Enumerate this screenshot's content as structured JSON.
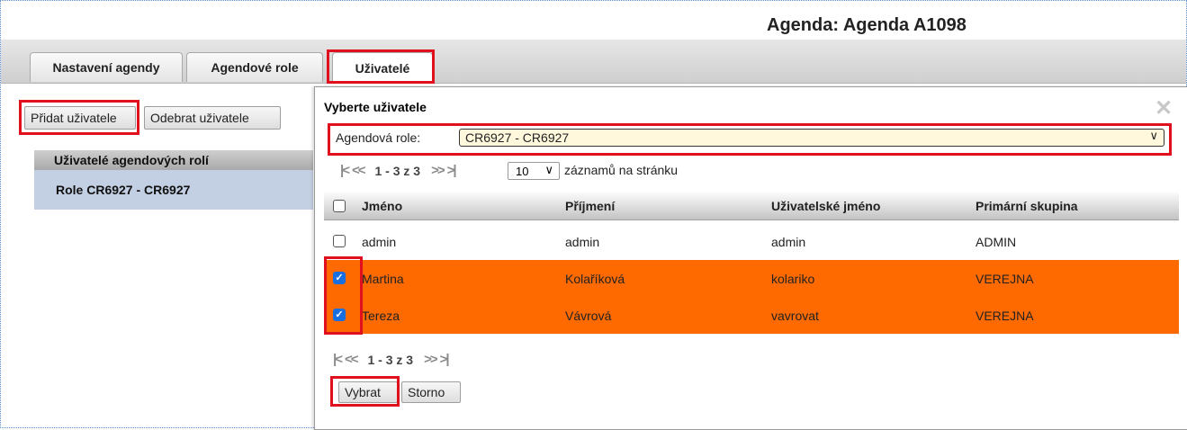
{
  "header": {
    "agenda_title": "Agenda: Agenda A1098"
  },
  "tabs": [
    {
      "label": "Nastavení agendy"
    },
    {
      "label": "Agendové role"
    },
    {
      "label": "Uživatelé"
    }
  ],
  "left": {
    "add_button": "Přidat uživatele",
    "remove_button": "Odebrat uživatele",
    "section_header": "Uživatelé agendových rolí",
    "role_item": "Role CR6927 - CR6927"
  },
  "dialog": {
    "title": "Vyberte uživatele",
    "role_label": "Agendová role:",
    "role_value": "CR6927 - CR6927",
    "pager_text": "1 - 3 z 3",
    "per_page_value": "10",
    "per_page_label": "záznamů na stránku",
    "columns": [
      "Jméno",
      "Příjmení",
      "Uživatelské jméno",
      "Primární skupina"
    ],
    "rows": [
      {
        "first": "admin",
        "last": "admin",
        "username": "admin",
        "group": "ADMIN",
        "checked": false
      },
      {
        "first": "Martina",
        "last": "Kolaříková",
        "username": "kolariko",
        "group": "VEREJNA",
        "checked": true
      },
      {
        "first": "Tereza",
        "last": "Vávrová",
        "username": "vavrovat",
        "group": "VEREJNA",
        "checked": true
      }
    ],
    "select_button": "Vybrat",
    "cancel_button": "Storno"
  },
  "colors": {
    "selected_row": "#ff6a00",
    "highlight": "#e0101e",
    "selected_role_bg": "#c3cfe2"
  }
}
